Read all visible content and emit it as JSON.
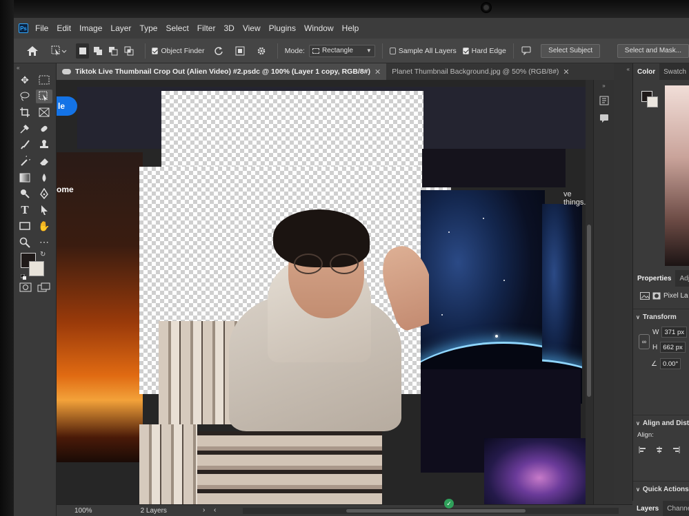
{
  "menu": {
    "items": [
      "File",
      "Edit",
      "Image",
      "Layer",
      "Type",
      "Select",
      "Filter",
      "3D",
      "View",
      "Plugins",
      "Window",
      "Help"
    ]
  },
  "options": {
    "object_finder": "Object Finder",
    "object_finder_checked": true,
    "mode_label": "Mode:",
    "mode_value": "Rectangle",
    "sample_all_layers": "Sample All Layers",
    "sample_all_layers_checked": false,
    "hard_edge": "Hard Edge",
    "hard_edge_checked": true,
    "select_subject": "Select Subject",
    "select_and_mask": "Select and Mask..."
  },
  "tabs": [
    {
      "label": "Tiktok Live Thumbnail Crop Out (Alien Video) #2.psdc @ 100% (Layer 1 copy, RGB/8#)",
      "active": true
    },
    {
      "label": "Planet Thumbnail Background.jpg @ 50% (RGB/8#)",
      "active": false
    }
  ],
  "canvas": {
    "pill_text": "le",
    "web_text_left": "ome",
    "web_text_right": "ve things."
  },
  "panels": {
    "color_tab": "Color",
    "swatches_tab": "Swatch",
    "properties_tab": "Properties",
    "adjustments_tab": "Adj",
    "pixel_layer": "Pixel La",
    "transform": "Transform",
    "w_label": "W",
    "w_value": "371 px",
    "h_label": "H",
    "h_value": "662 px",
    "angle_value": "0.00°",
    "align_title": "Align and Distr",
    "align_label": "Align:",
    "quick_actions": "Quick Actions",
    "layers_tab": "Layers",
    "channels_tab": "Channels"
  },
  "status": {
    "zoom": "100%",
    "layers": "2 Layers"
  },
  "colors": {
    "foreground": "#1f1a19",
    "background": "#e8e3da",
    "accent": "#1473e6"
  }
}
